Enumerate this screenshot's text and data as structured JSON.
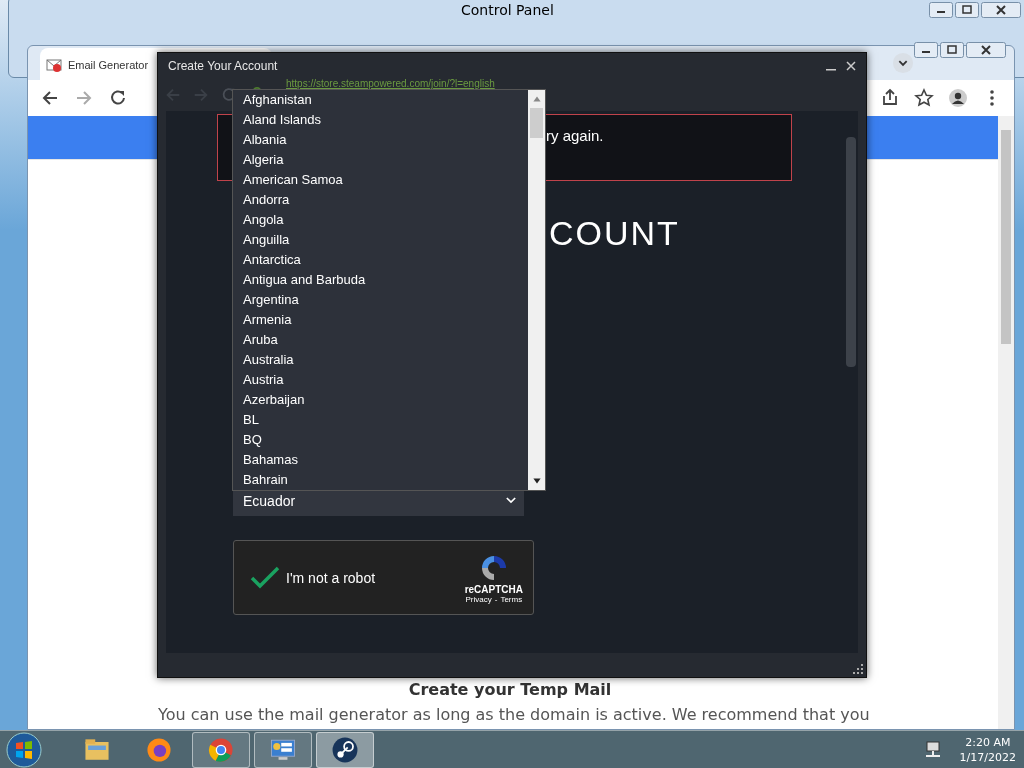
{
  "control_panel_window": {
    "title": "Control Panel"
  },
  "browser": {
    "tab": {
      "title": "Email Generator"
    },
    "page": {
      "heading": "Create your Temp Mail",
      "text": "You can use the mail generator as long as the domain is active. We recommend that you"
    }
  },
  "dialog": {
    "title": "Create Your Account",
    "url": "https://store.steampowered.com/join/?l=english",
    "error_fragments": [
      "ry again."
    ],
    "heading_fragment": "COUNT",
    "country_select": {
      "value": "Ecuador",
      "options": [
        {
          "label": "Afghanistan",
          "selected": false
        },
        {
          "label": "Aland Islands",
          "selected": false
        },
        {
          "label": "Albania",
          "selected": false
        },
        {
          "label": "Algeria",
          "selected": false
        },
        {
          "label": "American Samoa",
          "selected": false
        },
        {
          "label": "Andorra",
          "selected": false
        },
        {
          "label": "Angola",
          "selected": false
        },
        {
          "label": "Anguilla",
          "selected": false
        },
        {
          "label": "Antarctica",
          "selected": false
        },
        {
          "label": "Antigua and Barbuda",
          "selected": false
        },
        {
          "label": "Argentina",
          "selected": false
        },
        {
          "label": "Armenia",
          "selected": false
        },
        {
          "label": "Aruba",
          "selected": false
        },
        {
          "label": "Australia",
          "selected": false
        },
        {
          "label": "Austria",
          "selected": false
        },
        {
          "label": "Azerbaijan",
          "selected": false
        },
        {
          "label": "BL",
          "selected": false
        },
        {
          "label": "BQ",
          "selected": false
        },
        {
          "label": "Bahamas",
          "selected": false
        },
        {
          "label": "Bahrain",
          "selected": false
        }
      ]
    },
    "captcha": {
      "label": "I'm not a robot",
      "checked": true,
      "brand": "reCAPTCHA",
      "links": [
        "Privacy",
        "Terms"
      ],
      "separator": "-"
    }
  },
  "taskbar": {
    "apps": [
      {
        "kind": "explorer",
        "running": false,
        "selected": false
      },
      {
        "kind": "firefox",
        "running": false,
        "selected": false
      },
      {
        "kind": "chrome",
        "running": true,
        "selected": false
      },
      {
        "kind": "control-panel",
        "running": true,
        "selected": false
      },
      {
        "kind": "steam",
        "running": true,
        "selected": true
      }
    ],
    "clock": {
      "time": "2:20 AM",
      "date": "1/17/2022"
    }
  }
}
